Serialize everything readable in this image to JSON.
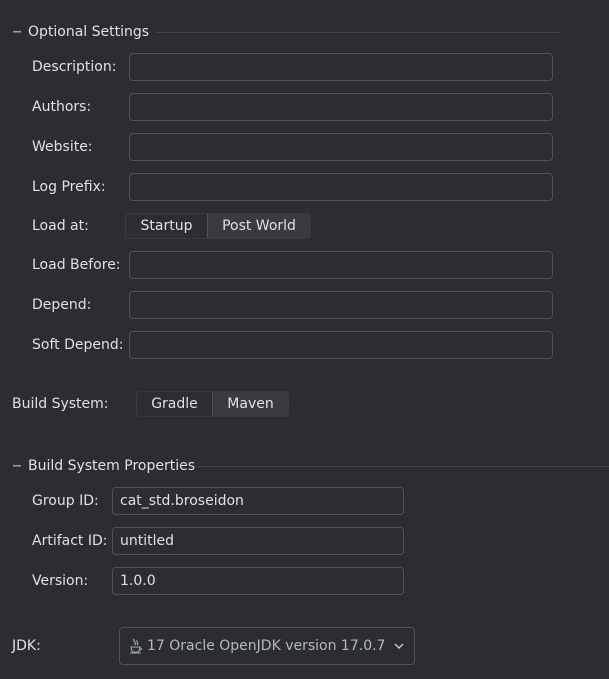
{
  "optional_settings": {
    "title": "Optional Settings",
    "fields": [
      {
        "label": "Description:",
        "value": ""
      },
      {
        "label": "Authors:",
        "value": ""
      },
      {
        "label": "Website:",
        "value": ""
      },
      {
        "label": "Log Prefix:",
        "value": ""
      }
    ],
    "load_at": {
      "label": "Load at:",
      "options": [
        "Startup",
        "Post World"
      ],
      "selected": "Post World"
    },
    "fields_after": [
      {
        "label": "Load Before:",
        "value": ""
      },
      {
        "label": "Depend:",
        "value": ""
      },
      {
        "label": "Soft Depend:",
        "value": ""
      }
    ]
  },
  "build_system": {
    "label": "Build System:",
    "options": [
      "Gradle",
      "Maven"
    ],
    "selected": "Maven"
  },
  "build_system_properties": {
    "title": "Build System Properties",
    "group_id": {
      "label": "Group ID:",
      "value": "cat_std.broseidon"
    },
    "artifact_id": {
      "label": "Artifact ID:",
      "value": "untitled"
    },
    "version": {
      "label": "Version:",
      "value": "1.0.0"
    }
  },
  "jdk": {
    "label": "JDK:",
    "selected": "17 Oracle OpenJDK version 17.0.7",
    "icon": "java-icon"
  },
  "icons": {
    "collapse": "minus-icon",
    "dropdown": "chevron-down-icon"
  },
  "colors": {
    "background": "#2b2d30",
    "border": "#4e5157",
    "text": "#dfe1e5",
    "selected_segment": "#393b40"
  }
}
